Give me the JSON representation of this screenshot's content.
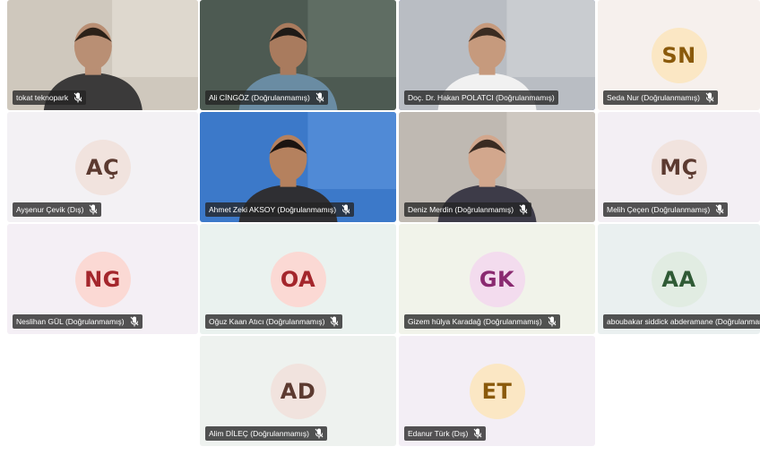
{
  "participants": [
    {
      "name": "tokat teknopark",
      "kind": "video",
      "mic_icon": "mic-off-icon",
      "active": false
    },
    {
      "name": "Ali CİNGÖZ (Doğrulanmamış)",
      "kind": "video",
      "mic_icon": "mic-off-icon",
      "active": false
    },
    {
      "name": "Doç. Dr. Hakan POLATCI (Doğrulanmamış)",
      "kind": "video",
      "mic_icon": "none",
      "active": true
    },
    {
      "name": "Seda Nur (Doğrulanmamış)",
      "kind": "avatar",
      "initials": "SN",
      "avatar_bg": "#fbe7c4",
      "avatar_fg": "#8a5a0b",
      "tile_bg": "#f6f0ed",
      "mic_icon": "mic-off-icon"
    },
    {
      "name": "Ayşenur Çevik (Dış)",
      "kind": "avatar",
      "initials": "AÇ",
      "avatar_bg": "#f1e3de",
      "avatar_fg": "#5c3a30",
      "tile_bg": "#f3f1f4",
      "mic_icon": "mic-off-icon"
    },
    {
      "name": "Ahmet Zeki AKSOY (Doğrulanmamış)",
      "kind": "video",
      "mic_icon": "mic-off-icon",
      "active": false
    },
    {
      "name": "Deniz Merdin (Doğrulanmamış)",
      "kind": "video",
      "mic_icon": "mic-off-icon",
      "active": false
    },
    {
      "name": "Melih Çeçen (Doğrulanmamış)",
      "kind": "avatar",
      "initials": "MÇ",
      "avatar_bg": "#f1e3de",
      "avatar_fg": "#5c3a30",
      "tile_bg": "#f3eff4",
      "mic_icon": "mic-off-icon"
    },
    {
      "name": "Neslihan GÜL (Doğrulanmamış)",
      "kind": "avatar",
      "initials": "NG",
      "avatar_bg": "#fbd9d4",
      "avatar_fg": "#a4262c",
      "tile_bg": "#f4eff5",
      "mic_icon": "mic-off-icon"
    },
    {
      "name": "Oğuz Kaan Atıcı (Doğrulanmamış)",
      "kind": "avatar",
      "initials": "OA",
      "avatar_bg": "#fbd9d4",
      "avatar_fg": "#a4262c",
      "tile_bg": "#eaf2ef",
      "mic_icon": "mic-off-icon"
    },
    {
      "name": "Gizem hülya Karadağ (Doğrulanmamış)",
      "kind": "avatar",
      "initials": "GK",
      "avatar_bg": "#f3dcee",
      "avatar_fg": "#8a2a70",
      "tile_bg": "#f1f3ea",
      "mic_icon": "mic-off-icon"
    },
    {
      "name": "aboubakar siddick abderamane (Doğrulanmamış)",
      "kind": "avatar",
      "initials": "AA",
      "avatar_bg": "#e1ece2",
      "avatar_fg": "#2f5a35",
      "tile_bg": "#eaf0f0",
      "mic_icon": "none"
    },
    {
      "name": "Alim DİLEÇ (Doğrulanmamış)",
      "kind": "avatar",
      "initials": "AD",
      "avatar_bg": "#f1e3de",
      "avatar_fg": "#5c3a30",
      "tile_bg": "#eef2ef",
      "mic_icon": "mic-off-icon"
    },
    {
      "name": "Edanur Türk (Dış)",
      "kind": "avatar",
      "initials": "ET",
      "avatar_bg": "#fbe7c4",
      "avatar_fg": "#8a5a0b",
      "tile_bg": "#f3eef5",
      "mic_icon": "mic-off-icon"
    }
  ]
}
